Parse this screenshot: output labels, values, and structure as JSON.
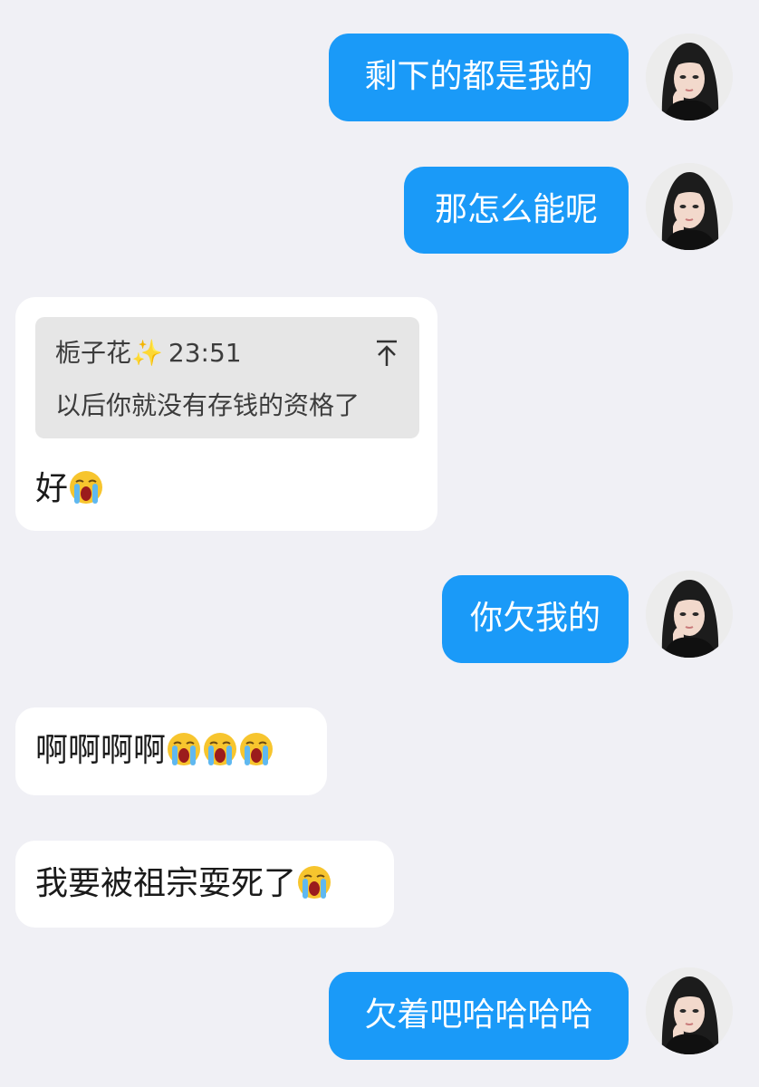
{
  "conversation": {
    "messages": [
      {
        "side": "sent",
        "text": "剩下的都是我的"
      },
      {
        "side": "sent",
        "text": "那怎么能呢"
      },
      {
        "side": "received",
        "quote": {
          "sender": "栀子花✨",
          "time": "23:51",
          "text": "以后你就没有存钱的资格了",
          "icon": "scroll-to-original-icon"
        },
        "text": "好",
        "emojis": [
          "loudly-crying-face"
        ]
      },
      {
        "side": "sent",
        "text": "你欠我的"
      },
      {
        "side": "received",
        "text": "啊啊啊啊",
        "emojis": [
          "loudly-crying-face",
          "loudly-crying-face",
          "loudly-crying-face"
        ]
      },
      {
        "side": "received",
        "text": "我要被祖宗耍死了",
        "emojis": [
          "loudly-crying-face"
        ]
      },
      {
        "side": "sent",
        "text": "欠着吧哈哈哈哈"
      }
    ]
  },
  "colors": {
    "background": "#f0f0f5",
    "sent_bubble": "#1a9af8",
    "received_bubble": "#ffffff",
    "quote_background": "#e6e6e6"
  }
}
